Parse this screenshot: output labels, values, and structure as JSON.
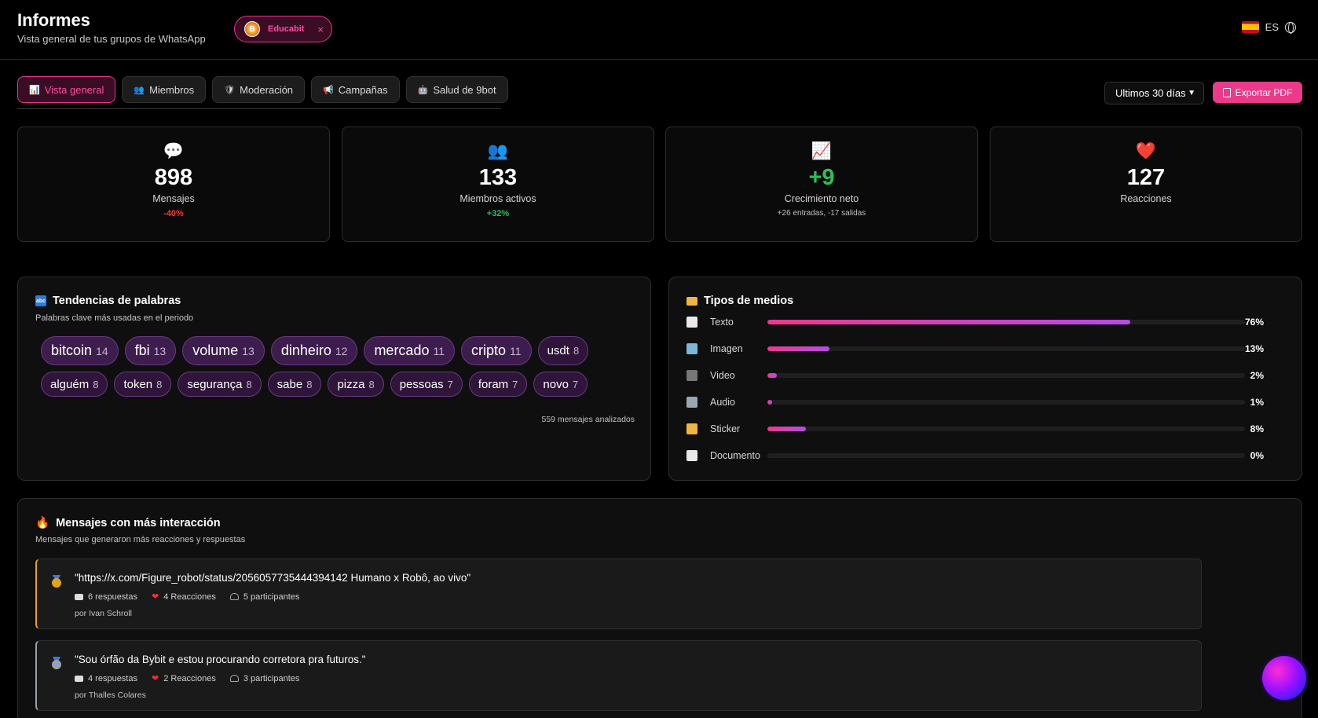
{
  "header": {
    "title": "Informes",
    "subtitle": "Vista general de tus grupos de WhatsApp",
    "group_chip": {
      "label": "Educabit",
      "close_icon": "×"
    },
    "language": "ES"
  },
  "tabs": [
    {
      "label": "Vista general",
      "icon": "📊"
    },
    {
      "label": "Miembros",
      "icon": "👥"
    },
    {
      "label": "Moderación",
      "icon": "🛡"
    },
    {
      "label": "Campañas",
      "icon": "📢"
    },
    {
      "label": "Salud de 9bot",
      "icon": "🤖"
    }
  ],
  "controls": {
    "period": "Ultimos 30 días",
    "export_label": "Exportar PDF"
  },
  "stats": [
    {
      "icon": "💬",
      "value": "898",
      "label": "Mensajes",
      "delta": "-40%"
    },
    {
      "icon": "👥",
      "value": "133",
      "label": "Miembros activos",
      "delta": "+32%"
    },
    {
      "icon": "📈",
      "value": "+9",
      "label": "Crecimiento neto",
      "delta": "+26 entradas, -17 salidas"
    },
    {
      "icon": "❤️",
      "value": "127",
      "label": "Reacciones",
      "delta": ""
    }
  ],
  "word_trends": {
    "title": "Tendencias de palabras",
    "subtitle": "Palabras clave más usadas en el periodo",
    "icon": "abc",
    "words": [
      {
        "word": "bitcoin",
        "count": "14"
      },
      {
        "word": "fbi",
        "count": "13"
      },
      {
        "word": "volume",
        "count": "13"
      },
      {
        "word": "dinheiro",
        "count": "12"
      },
      {
        "word": "mercado",
        "count": "11"
      },
      {
        "word": "cripto",
        "count": "11"
      },
      {
        "word": "usdt",
        "count": "8"
      },
      {
        "word": "alguém",
        "count": "8"
      },
      {
        "word": "token",
        "count": "8"
      },
      {
        "word": "segurança",
        "count": "8"
      },
      {
        "word": "sabe",
        "count": "8"
      },
      {
        "word": "pizza",
        "count": "8"
      },
      {
        "word": "pessoas",
        "count": "7"
      },
      {
        "word": "foram",
        "count": "7"
      },
      {
        "word": "novo",
        "count": "7"
      }
    ],
    "analyzed": "559 mensajes analizados"
  },
  "media_types": {
    "title": "Tipos de medios",
    "items": [
      {
        "label": "Texto",
        "pct": "76%",
        "value": 76,
        "icon_color": "#e9e9e9"
      },
      {
        "label": "Imagen",
        "pct": "13%",
        "value": 13,
        "icon_color": "#7ab8d8"
      },
      {
        "label": "Video",
        "pct": "2%",
        "value": 2,
        "icon_color": "#777777"
      },
      {
        "label": "Audio",
        "pct": "1%",
        "value": 1,
        "icon_color": "#9aa6b0"
      },
      {
        "label": "Sticker",
        "pct": "8%",
        "value": 8,
        "icon_color": "#f2b441"
      },
      {
        "label": "Documento",
        "pct": "0%",
        "value": 0,
        "icon_color": "#e9e9e9"
      }
    ]
  },
  "top_messages": {
    "title": "Mensajes con más interacción",
    "subtitle": "Mensajes que generaron más reacciones y respuestas",
    "items": [
      {
        "text": "\"https://x.com/Figure_robot/status/2056057735444394142 Humano x Robô, ao vivo\"",
        "replies": "6 respuestas",
        "reactions": "4 Reacciones",
        "participants": "5 participantes",
        "author": "por Ivan Schroll"
      },
      {
        "text": "\"Sou órfão da Bybit e estou procurando corretora pra futuros.\"",
        "replies": "4 respuestas",
        "reactions": "2 Reacciones",
        "participants": "3 participantes",
        "author": "por Thalles Colares"
      }
    ]
  },
  "colors": {
    "accent": "#ec3a8b",
    "positive": "#2bbf5b",
    "negative": "#ef3b3b"
  }
}
